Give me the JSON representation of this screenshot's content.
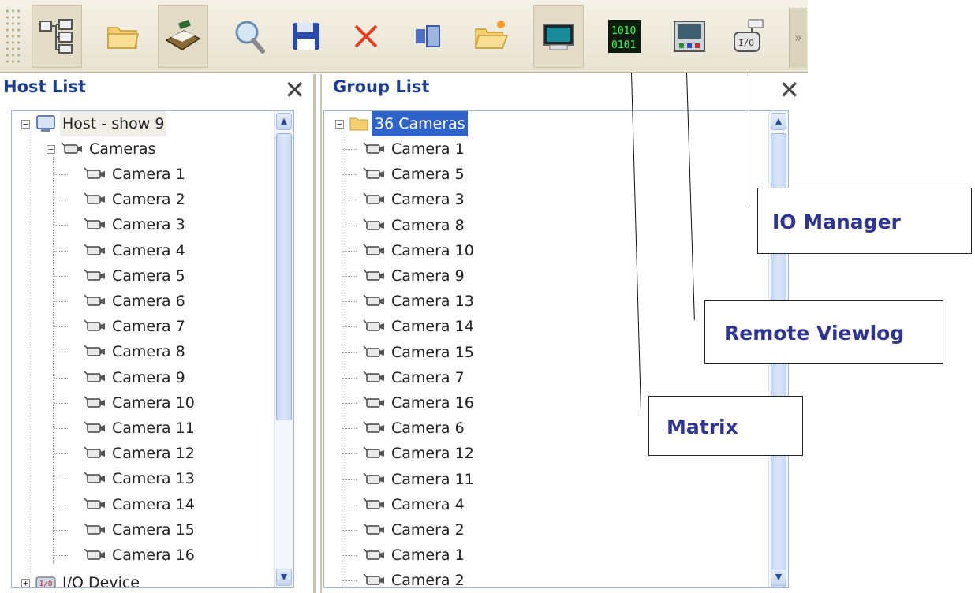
{
  "toolbar": {
    "buttons": [
      {
        "name": "host-tree-button",
        "icon": "host-tree-icon"
      },
      {
        "name": "open-folder-button",
        "icon": "folder-icon"
      },
      {
        "name": "ptz-button",
        "icon": "ptz-device-icon"
      },
      {
        "name": "search-button",
        "icon": "search-icon"
      },
      {
        "name": "save-button",
        "icon": "floppy-icon"
      },
      {
        "name": "delete-button",
        "icon": "close-icon"
      },
      {
        "name": "device-button",
        "icon": "device-icon"
      },
      {
        "name": "new-folder-button",
        "icon": "new-folder-icon"
      },
      {
        "name": "monitor-button",
        "icon": "monitor-icon"
      },
      {
        "name": "matrix-button",
        "icon": "matrix-icon"
      },
      {
        "name": "remote-viewlog-button",
        "icon": "remote-viewlog-icon"
      },
      {
        "name": "io-manager-button",
        "icon": "io-manager-icon"
      }
    ]
  },
  "host_list": {
    "title": "Host List",
    "close_label": "✕",
    "host": "Host - show 9",
    "cameras_group": "Cameras",
    "cameras": [
      "Camera 1",
      "Camera 2",
      "Camera 3",
      "Camera 4",
      "Camera 5",
      "Camera 6",
      "Camera 7",
      "Camera 8",
      "Camera 9",
      "Camera 10",
      "Camera 11",
      "Camera 12",
      "Camera 13",
      "Camera 14",
      "Camera 15",
      "Camera 16"
    ],
    "io_device": "I/O Device"
  },
  "group_list": {
    "title": "Group List",
    "close_label": "✕",
    "group": "36 Cameras",
    "cameras": [
      "Camera 1",
      "Camera 5",
      "Camera 3",
      "Camera 8",
      "Camera 10",
      "Camera 9",
      "Camera 13",
      "Camera 14",
      "Camera 15",
      "Camera 7",
      "Camera 16",
      "Camera 6",
      "Camera 12",
      "Camera 11",
      "Camera 4",
      "Camera 2",
      "Camera 1",
      "Camera 2"
    ]
  },
  "callouts": {
    "io_manager": "IO Manager",
    "remote_viewlog": "Remote Viewlog",
    "matrix": "Matrix"
  }
}
